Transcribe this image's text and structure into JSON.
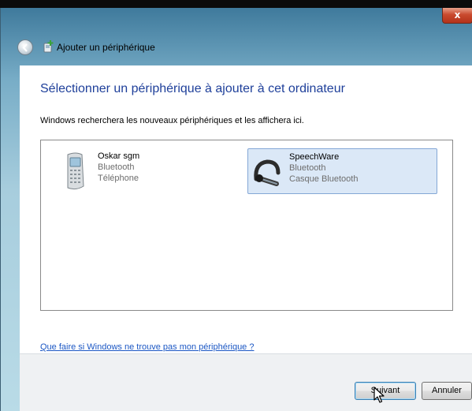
{
  "window": {
    "title": "Ajouter un périphérique",
    "close_label": "x"
  },
  "main": {
    "heading": "Sélectionner un périphérique à ajouter à cet ordinateur",
    "description": "Windows recherchera les nouveaux périphériques et les affichera ici.",
    "devices": [
      {
        "name": "Oskar sgm",
        "type": "Bluetooth",
        "category": "Téléphone",
        "icon": "mobile-phone-icon",
        "selected": false
      },
      {
        "name": "SpeechWare",
        "type": "Bluetooth",
        "category": "Casque Bluetooth",
        "icon": "bluetooth-headset-icon",
        "selected": true
      }
    ],
    "help_link": "Que faire si Windows ne trouve pas mon périphérique ?"
  },
  "footer": {
    "next_label": "Suivant",
    "cancel_label": "Annuler"
  },
  "colors": {
    "heading": "#1e3f9a",
    "link": "#1b57c4",
    "selection": "#dbe8f7"
  }
}
